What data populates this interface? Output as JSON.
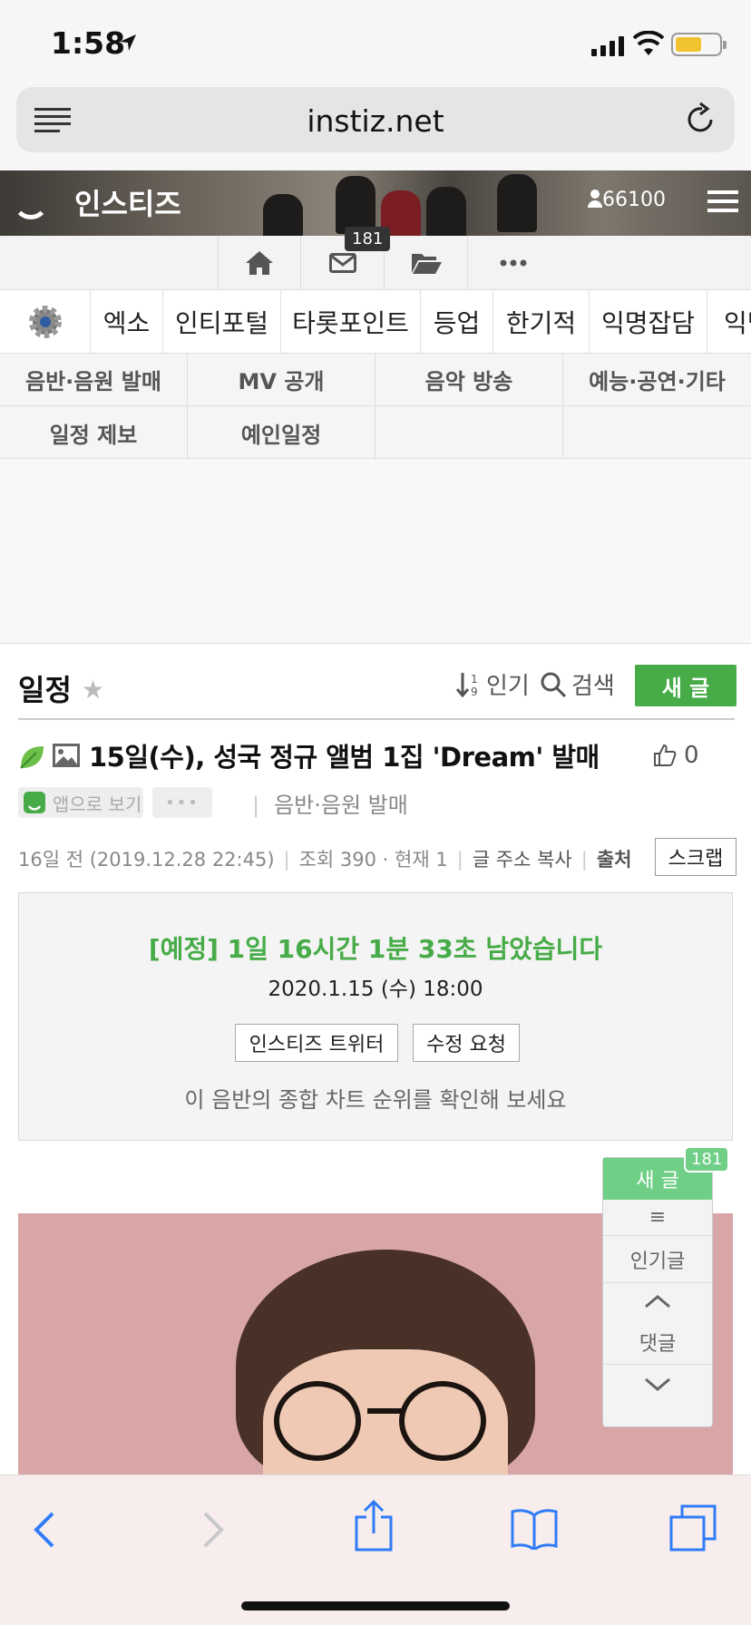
{
  "status_bar": {
    "time": "1:58"
  },
  "browser": {
    "url": "instiz.net"
  },
  "site": {
    "logo": "인스티즈",
    "user_count": "66100"
  },
  "icon_nav": {
    "message_badge": "181"
  },
  "category_tabs": [
    "엑소",
    "인티포털",
    "타롯포인트",
    "등업",
    "한기적",
    "익명잡담",
    "익명"
  ],
  "subcategories": [
    "음반·음원 발매",
    "MV 공개",
    "음악 방송",
    "예능·공연·기타",
    "일정 제보",
    "예인일정"
  ],
  "board": {
    "title": "일정",
    "sort_label": "인기",
    "search_label": "검색",
    "new_post_label": "새 글"
  },
  "post": {
    "title": "15일(수), 성국 정규 앨범 1집 'Dream' 발매",
    "likes": "0",
    "app_view_label": "앱으로 보기",
    "more_label": "•••",
    "category": "음반·음원 발매",
    "meta": {
      "date": "16일 전 (2019.12.28 22:45)",
      "views": "조회 390 · 현재 1",
      "copy_link": "글 주소 복사",
      "source": "출처"
    },
    "scrap_label": "스크랩"
  },
  "schedule_box": {
    "countdown": "[예정] 1일 16시간 1분 33초 남았습니다",
    "datetime": "2020.1.15 (수) 18:00",
    "twitter_button": "인스티즈 트위터",
    "edit_request_button": "수정 요청",
    "chart_hint": "이 음반의 종합 차트 순위를 확인해 보세요"
  },
  "float_panel": {
    "new_post": "새 글",
    "badge": "181",
    "menu_glyph": "≡",
    "popular": "인기글",
    "comments": "댓글"
  },
  "colors": {
    "brand_green": "#47ac48",
    "float_green": "#6fcf86",
    "toolbar_bg": "#f8eded",
    "ios_blue": "#2f7cf6"
  },
  "icons": [
    "location-arrow-icon",
    "signal-icon",
    "wifi-icon",
    "battery-icon",
    "reader-menu-icon",
    "reload-icon",
    "user-icon",
    "hamburger-icon",
    "home-icon",
    "mail-icon",
    "folder-icon",
    "more-icon",
    "gear-icon",
    "leaf-icon",
    "image-icon",
    "thumbs-up-icon",
    "sort-icon",
    "search-icon",
    "chevron-up-icon",
    "chevron-down-icon",
    "back-icon",
    "forward-icon",
    "share-icon",
    "bookmarks-icon",
    "tabs-icon"
  ]
}
